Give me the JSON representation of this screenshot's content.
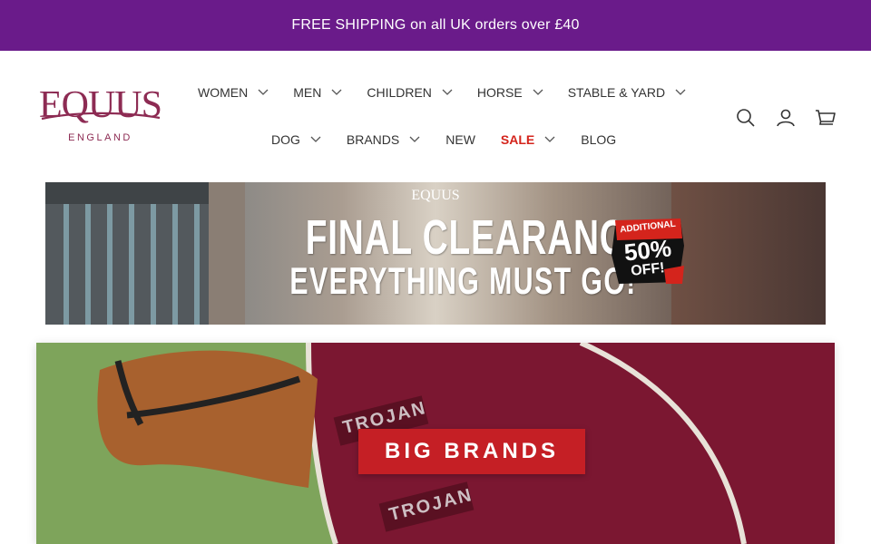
{
  "announcement": {
    "text": "FREE SHIPPING on all UK orders over £40"
  },
  "brand": {
    "wordmark": "EQUUS",
    "sub": "ENGLAND",
    "color": "#8d2b53"
  },
  "nav": {
    "row1": [
      {
        "label": "WOMEN",
        "has_dropdown": true
      },
      {
        "label": "MEN",
        "has_dropdown": true
      },
      {
        "label": "CHILDREN",
        "has_dropdown": true
      },
      {
        "label": "HORSE",
        "has_dropdown": true
      },
      {
        "label": "STABLE & YARD",
        "has_dropdown": true
      }
    ],
    "row2": [
      {
        "label": "DOG",
        "has_dropdown": true
      },
      {
        "label": "BRANDS",
        "has_dropdown": true
      },
      {
        "label": "NEW",
        "has_dropdown": false
      },
      {
        "label": "SALE",
        "has_dropdown": true,
        "highlight_color": "#d4241c"
      },
      {
        "label": "BLOG",
        "has_dropdown": false
      }
    ]
  },
  "header_icons": [
    "search-icon",
    "account-icon",
    "cart-icon"
  ],
  "promo_banner": {
    "logo": "EQUUS",
    "headline": "FINAL CLEARANCE",
    "subline": "EVERYTHING MUST GO!",
    "badge": {
      "top": "ADDITIONAL",
      "percent": "50%",
      "bottom": "OFF!"
    }
  },
  "feature_banner": {
    "cta": "BIG BRANDS",
    "cta_color": "#c51f25",
    "rug_labels": [
      "TROJAN",
      "TROJAN"
    ]
  },
  "colors": {
    "announcement_bg": "#6a1b8a",
    "nav_text": "#333333"
  }
}
